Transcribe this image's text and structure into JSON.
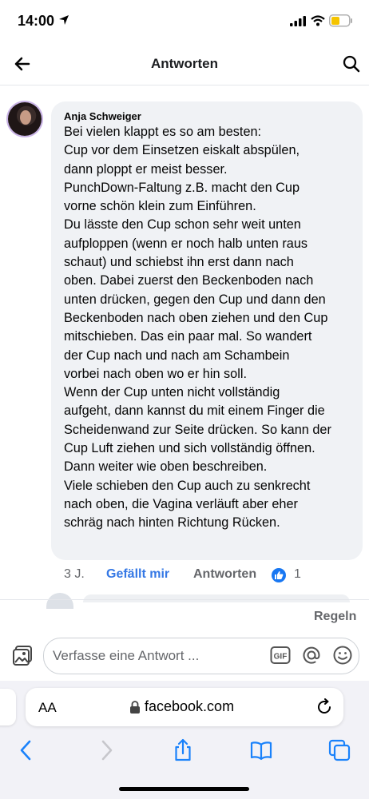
{
  "status_bar": {
    "time": "14:00"
  },
  "header": {
    "title": "Antworten"
  },
  "comment": {
    "author": "Anja Schweiger",
    "lines": [
      "Bei vielen klappt es so am besten:",
      "Cup vor dem Einsetzen eiskalt abspülen,",
      "dann ploppt er meist besser.",
      "PunchDown-Faltung z.B. macht den Cup",
      "vorne schön klein zum Einführen.",
      "Du lässte den Cup schon sehr weit unten",
      "aufploppen (wenn er noch halb unten raus",
      "schaut) und schiebst ihn erst dann nach",
      "oben. Dabei zuerst den Beckenboden nach",
      "unten drücken, gegen den Cup und dann den",
      "Beckenboden nach oben ziehen und den Cup",
      "mitschieben. Das ein paar mal. So wandert",
      "der Cup nach und nach am Schambein",
      "vorbei nach oben wo er hin soll.",
      "Wenn der Cup unten nicht vollständig",
      "aufgeht, dann kannst du mit einem Finger die",
      "Scheidenwand zur Seite drücken. So kann der",
      "Cup Luft ziehen und sich vollständig öffnen.",
      "Dann weiter wie oben beschreiben.",
      "Viele schieben den Cup auch zu senkrecht",
      "nach oben, die Vagina verläuft aber eher",
      "schräg nach hinten Richtung Rücken."
    ],
    "time": "3 J.",
    "like_label": "Gefällt mir",
    "reply_label": "Antworten",
    "reaction_count": "1"
  },
  "rules_label": "Regeln",
  "reply_box": {
    "placeholder": "Verfasse eine Antwort ...",
    "gif_label": "GIF"
  },
  "browser": {
    "text_size_label": "AA",
    "url": "facebook.com"
  },
  "colors": {
    "link_blue": "#3578e5",
    "like_blue": "#1877f2",
    "bubble_bg": "#f0f2f5",
    "safari_blue": "#1a82fb"
  },
  "icons": [
    "location-arrow-icon",
    "signal-icon",
    "wifi-icon",
    "battery-icon",
    "back-arrow-icon",
    "search-icon",
    "like-icon",
    "photo-icon",
    "gif-icon",
    "at-icon",
    "emoji-icon",
    "lock-icon",
    "reload-icon",
    "chevron-left-icon",
    "chevron-right-icon",
    "share-icon",
    "bookmarks-icon",
    "tabs-icon"
  ]
}
